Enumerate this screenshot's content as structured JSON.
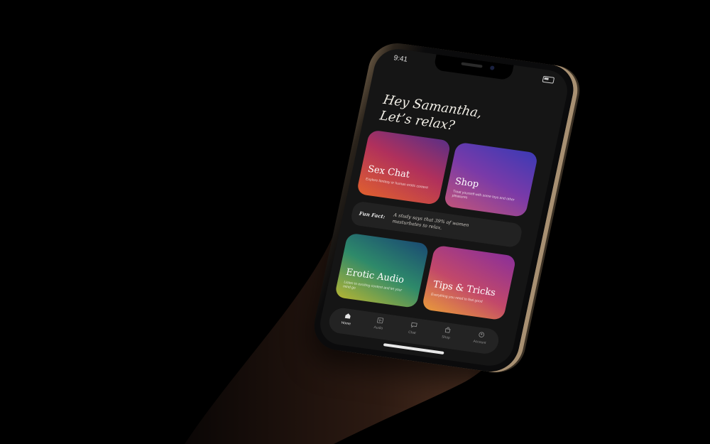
{
  "status": {
    "time": "9:41"
  },
  "greeting": {
    "line1": "Hey Samantha,",
    "line2": "Let’s relax?"
  },
  "cards": [
    {
      "title": "Sex Chat",
      "subtitle": "Explore fantasy or human erotic content"
    },
    {
      "title": "Shop",
      "subtitle": "Treat yourself with some toys and other pleasures"
    },
    {
      "title": "Erotic Audio",
      "subtitle": "Listen to exciting content and let your mind go"
    },
    {
      "title": "Tips & Tricks",
      "subtitle": "Everything you need to feel good"
    }
  ],
  "fun_fact": {
    "label": "Fun Fact:",
    "text": "A study says that 39% of women masturbates to relax."
  },
  "tabs": [
    {
      "label": "Home",
      "icon": "home-icon"
    },
    {
      "label": "Audio",
      "icon": "audio-icon"
    },
    {
      "label": "Chat",
      "icon": "chat-icon"
    },
    {
      "label": "Shop",
      "icon": "shop-icon"
    },
    {
      "label": "Account",
      "icon": "account-icon"
    }
  ],
  "colors": {
    "background": "#000000",
    "screen": "#151515",
    "frame_gold": "#a89072"
  }
}
